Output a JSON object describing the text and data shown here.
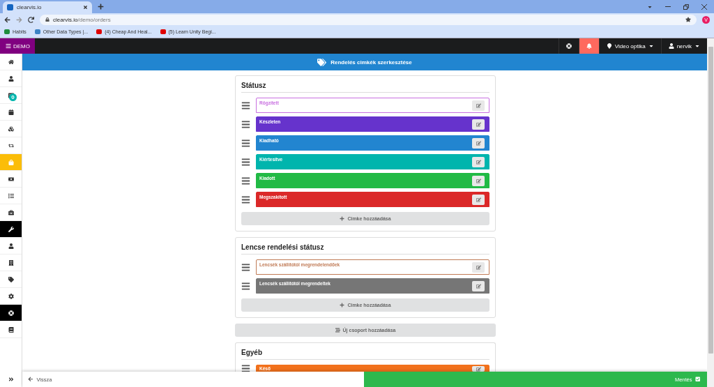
{
  "browser": {
    "tab_title": "clearvis.io",
    "url_host": "clearvis.io",
    "url_path": "/demo/orders",
    "avatar": "V",
    "bookmarks": [
      {
        "label": "Habits",
        "color": "#1e8e3e"
      },
      {
        "label": "Other Data Types |...",
        "color": "#3b82c4"
      },
      {
        "label": "(4) Cheap And Heal...",
        "color": "#e00000"
      },
      {
        "label": "(5) Learn Unity Begi...",
        "color": "#e00000"
      }
    ]
  },
  "topbar": {
    "brand": "DEMO",
    "location": "Video optika",
    "user": "nervik"
  },
  "sidebar": {
    "items": [
      {
        "selected": false,
        "dark": false
      },
      {
        "selected": false,
        "dark": false
      },
      {
        "selected": false,
        "dark": false,
        "badge": "0"
      },
      {
        "selected": false,
        "dark": false
      },
      {
        "selected": false,
        "dark": false
      },
      {
        "selected": false,
        "dark": false
      },
      {
        "selected": true,
        "dark": false
      },
      {
        "selected": false,
        "dark": false
      },
      {
        "selected": false,
        "dark": false
      },
      {
        "selected": false,
        "dark": false
      },
      {
        "selected": false,
        "dark": true
      },
      {
        "selected": false,
        "dark": false
      },
      {
        "selected": false,
        "dark": false
      },
      {
        "selected": false,
        "dark": false
      },
      {
        "selected": false,
        "dark": false
      },
      {
        "selected": false,
        "dark": true
      },
      {
        "selected": false,
        "dark": false
      }
    ]
  },
  "header": {
    "title": "Rendelés cimkék szerkesztése"
  },
  "groups": [
    {
      "title": "Státusz",
      "add_label": "Cimke hozzáadása",
      "tags": [
        {
          "label": "Rögzített",
          "color": "#c86fe0",
          "outlined": true
        },
        {
          "label": "Készleten",
          "color": "#6633cc",
          "outlined": false
        },
        {
          "label": "Kiadható",
          "color": "#2285d0",
          "outlined": false
        },
        {
          "label": "Kiértesítve",
          "color": "#00b5ad",
          "outlined": false
        },
        {
          "label": "Kiadott",
          "color": "#21ba45",
          "outlined": false
        },
        {
          "label": "Megszakított",
          "color": "#db2828",
          "outlined": false
        }
      ]
    },
    {
      "title": "Lencse rendelési státusz",
      "add_label": "Cimke hozzáadása",
      "tags": [
        {
          "label": "Lencsék szállítótól megrendelendőek",
          "color": "#c07a55",
          "outlined": true
        },
        {
          "label": "Lencsék szállítótól megrendeltek",
          "color": "#767676",
          "outlined": false
        }
      ]
    }
  ],
  "new_group_label": "Új csoport hozzáadása",
  "partial_group": {
    "title": "Egyéb",
    "tags": [
      {
        "label": "Késő",
        "color": "#f2711c",
        "outlined": false
      }
    ]
  },
  "footer": {
    "back": "Vissza",
    "save": "Mentés"
  }
}
